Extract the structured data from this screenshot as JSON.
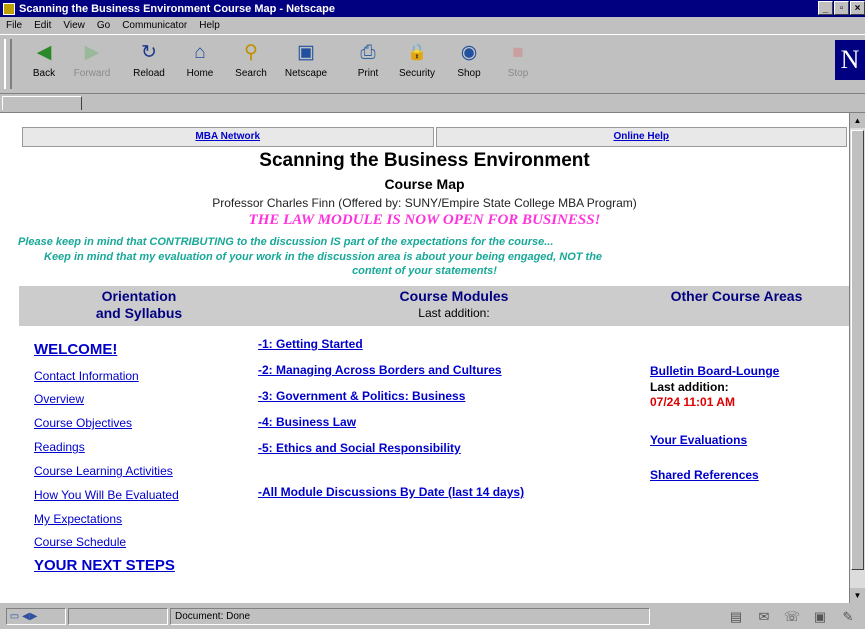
{
  "window": {
    "title": "Scanning the Business Environment Course Map - Netscape",
    "buttons": [
      "_",
      "▫",
      "×"
    ]
  },
  "menu": [
    "File",
    "Edit",
    "View",
    "Go",
    "Communicator",
    "Help"
  ],
  "toolbar": [
    {
      "label": "Back",
      "icon": "back-icon",
      "glyph": "◀",
      "enabled": true
    },
    {
      "label": "Forward",
      "icon": "forward-icon",
      "glyph": "▶",
      "enabled": false
    },
    {
      "label": "Reload",
      "icon": "reload-icon",
      "glyph": "↻",
      "enabled": true
    },
    {
      "label": "Home",
      "icon": "home-icon",
      "glyph": "⌂",
      "enabled": true
    },
    {
      "label": "Search",
      "icon": "search-icon",
      "glyph": "⚲",
      "enabled": true
    },
    {
      "label": "Netscape",
      "icon": "netscape-icon",
      "glyph": "▣",
      "enabled": true
    },
    {
      "label": "Print",
      "icon": "print-icon",
      "glyph": "⎙",
      "enabled": true
    },
    {
      "label": "Security",
      "icon": "security-icon",
      "glyph": "🔒",
      "enabled": true
    },
    {
      "label": "Shop",
      "icon": "shop-icon",
      "glyph": "◉",
      "enabled": true
    },
    {
      "label": "Stop",
      "icon": "stop-icon",
      "glyph": "■",
      "enabled": false
    }
  ],
  "brand_logo": "N",
  "page": {
    "nav": {
      "mba": "MBA Network",
      "help": "Online Help"
    },
    "title": "Scanning the Business Environment",
    "subtitle": "Course Map",
    "professor": "Professor Charles Finn (Offered by: SUNY/Empire State College MBA Program)",
    "law_notice": "THE LAW MODULE IS NOW OPEN FOR BUSINESS!",
    "note1": "Please keep in mind that CONTRIBUTING to the discussion IS part of the expectations for the course...",
    "note2_line1": "Keep in mind that my evaluation of your work in the discussion area is about your being engaged, NOT the",
    "note2_line2": "content of your statements!",
    "col_left_title_1": "Orientation",
    "col_left_title_2": "and Syllabus",
    "col_mid_title": "Course Modules",
    "col_mid_sub": "Last addition:",
    "col_right_title": "Other Course Areas",
    "welcome": "WELCOME!",
    "left_links": [
      "Contact Information",
      "Overview",
      "Course Objectives",
      "Readings",
      "Course Learning Activities",
      "How You Will Be Evaluated",
      "My Expectations",
      "Course Schedule"
    ],
    "next_steps": "YOUR NEXT STEPS",
    "modules": [
      "-1: Getting Started",
      "-2: Managing Across Borders and Cultures",
      "-3: Government & Politics: Business",
      "-4: Business Law",
      "-5: Ethics and Social Responsibility"
    ],
    "all_discussions": "-All Module Discussions By Date (last 14 days)",
    "bulletin": "Bulletin Board-Lounge",
    "bulletin_last_label": "Last addition:",
    "bulletin_last_time": "07/24 11:01 AM",
    "evaluations": "Your Evaluations",
    "references": "Shared References"
  },
  "status": {
    "text": "Document: Done"
  },
  "colors": {
    "link": "#0000cc",
    "notice": "#ff33dd",
    "note": "#18a898",
    "header_text": "#000080",
    "timestamp": "#dd0000"
  }
}
